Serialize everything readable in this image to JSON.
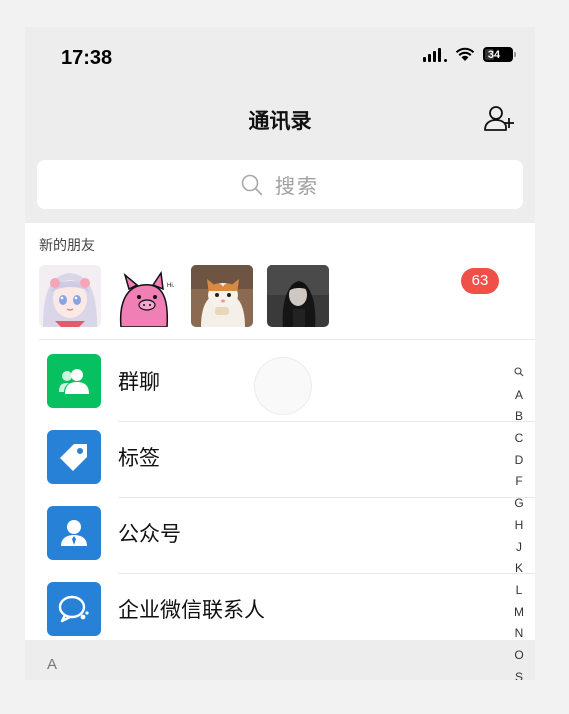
{
  "status": {
    "time": "17:38",
    "battery": "34",
    "battery_level": 0.34
  },
  "header": {
    "title": "通讯录"
  },
  "search": {
    "placeholder": "搜索"
  },
  "new_friends": {
    "label": "新的朋友",
    "badge": "63",
    "avatars": [
      "anime-girl",
      "pink-pig",
      "cat",
      "girl-photo"
    ]
  },
  "menu": [
    {
      "label": "群聊",
      "icon": "group-chat-icon",
      "color": "#07c160"
    },
    {
      "label": "标签",
      "icon": "tag-icon",
      "color": "#2782d7"
    },
    {
      "label": "公众号",
      "icon": "official-account-icon",
      "color": "#2782d7"
    },
    {
      "label": "企业微信联系人",
      "icon": "work-contacts-icon",
      "color": "#2782d7"
    }
  ],
  "section": {
    "A": "A"
  },
  "index": [
    "Q",
    "A",
    "B",
    "C",
    "D",
    "F",
    "G",
    "H",
    "J",
    "K",
    "L",
    "M",
    "N",
    "O",
    "S"
  ]
}
